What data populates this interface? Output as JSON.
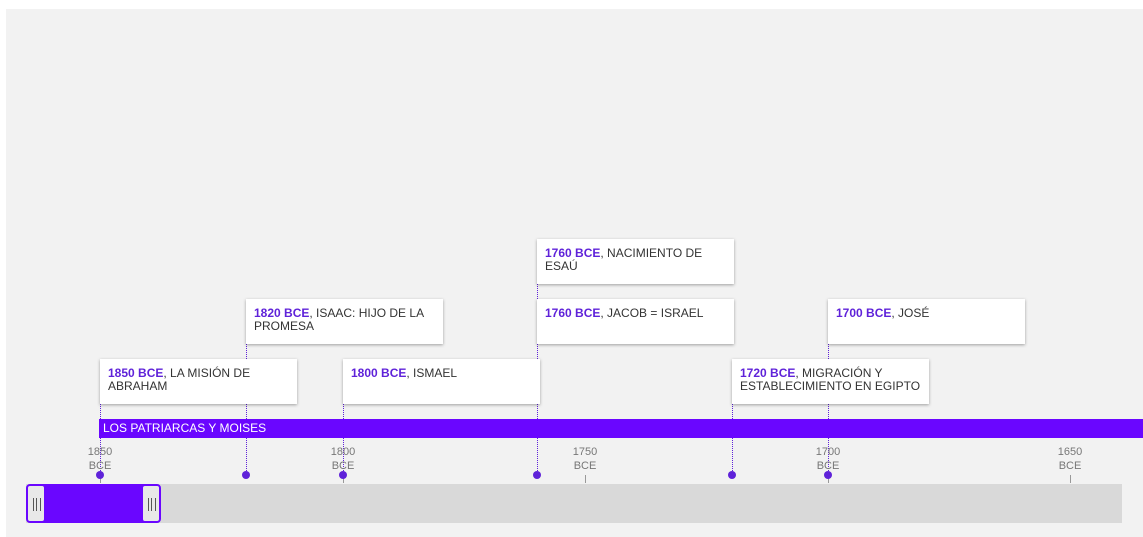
{
  "accent_color": "#6a06ff",
  "events": [
    {
      "date": "1850 BCE",
      "title": "LA MISIÓN DE ABRAHAM"
    },
    {
      "date": "1820 BCE",
      "title": "ISAAC: HIJO DE LA PROMESA"
    },
    {
      "date": "1800 BCE",
      "title": "ISMAEL"
    },
    {
      "date": "1760 BCE",
      "title": "NACIMIENTO DE ESAÚ"
    },
    {
      "date": "1760 BCE",
      "title": "JACOB = ISRAEL"
    },
    {
      "date": "1720 BCE",
      "title": "MIGRACIÓN Y ESTABLECIMIENTO EN EGIPTO"
    },
    {
      "date": "1700 BCE",
      "title": "JOSÉ"
    }
  ],
  "era": {
    "label": "LOS PATRIARCAS Y MOISES"
  },
  "axis_ticks": [
    {
      "year": "1850",
      "era": "BCE"
    },
    {
      "year": "1800",
      "era": "BCE"
    },
    {
      "year": "1750",
      "era": "BCE"
    },
    {
      "year": "1700",
      "era": "BCE"
    },
    {
      "year": "1650",
      "era": "BCE"
    }
  ]
}
